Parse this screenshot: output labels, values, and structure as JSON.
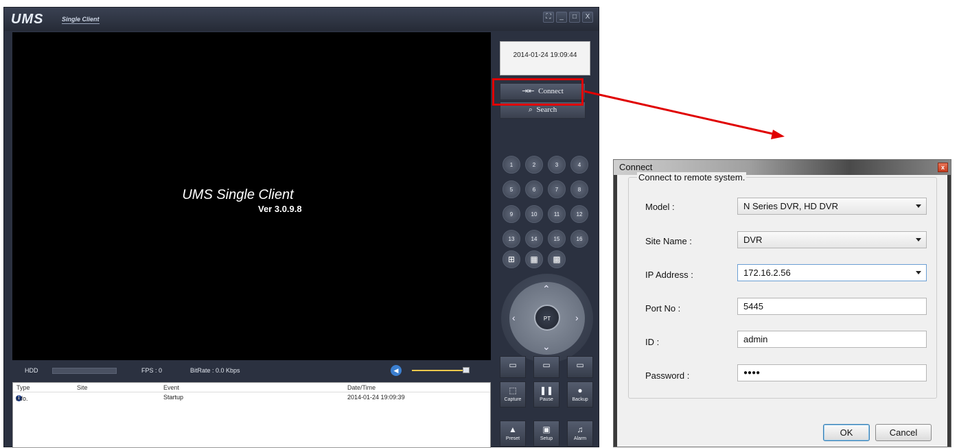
{
  "app": {
    "logo": "UMS",
    "logo_sub": "Single Client",
    "window_buttons": [
      "⛶",
      "_",
      "□",
      "X"
    ]
  },
  "video": {
    "title": "UMS Single Client",
    "version": "Ver 3.0.9.8"
  },
  "status": {
    "hdd_label": "HDD",
    "fps": "FPS :  0",
    "bitrate": "BitRate :  0.0 Kbps"
  },
  "log": {
    "columns": [
      "Type",
      "Site",
      "Event",
      "Date/Time"
    ],
    "rows": [
      {
        "type": "Info.",
        "site": "",
        "event": "Startup",
        "datetime": "2014-01-24 19:09:39"
      }
    ]
  },
  "panel": {
    "datetime": "2014-01-24 19:09:44",
    "connect_label": "Connect",
    "search_label": "Search",
    "channels": [
      "1",
      "2",
      "3",
      "4",
      "5",
      "6",
      "7",
      "8",
      "9",
      "10",
      "11",
      "12",
      "13",
      "14",
      "15",
      "16"
    ],
    "ptz_label": "PT",
    "row1": [
      "",
      "",
      ""
    ],
    "row2": [
      "Capture",
      "Pause",
      "Backup"
    ],
    "row3": [
      "Preset",
      "Setup",
      "Alarm"
    ]
  },
  "dialog": {
    "title": "Connect",
    "group_label": "Connect to remote system.",
    "model_label": "Model :",
    "model_value": "N Series DVR, HD DVR",
    "site_label": "Site Name :",
    "site_value": "DVR",
    "ip_label": "IP Address :",
    "ip_value": "172.16.2.56",
    "port_label": "Port No :",
    "port_value": "5445",
    "id_label": "ID :",
    "id_value": "admin",
    "password_label": "Password :",
    "password_value": "●●●●",
    "ok_label": "OK",
    "cancel_label": "Cancel"
  }
}
